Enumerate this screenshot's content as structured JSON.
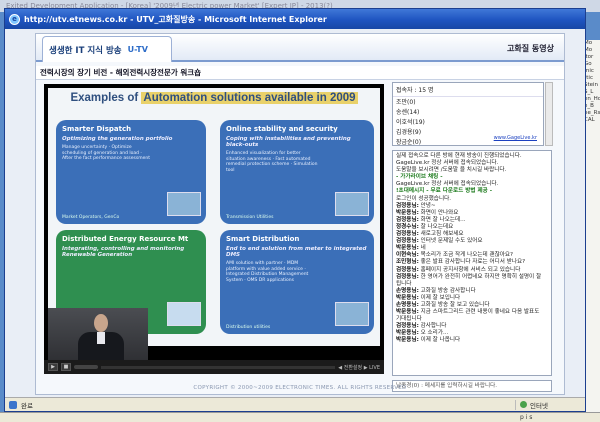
{
  "background": {
    "top_strip": "Exited Development Application - [Korea] '2009년 Electric power Market' [Expert IP] - 2013(?)"
  },
  "window": {
    "title": "http://utv.etnews.co.kr - UTV_고화질방송 - Microsoft Internet Explorer"
  },
  "popup": {
    "tab_label": "생생한 IT 지식 방송",
    "logo": "U-TV",
    "channel": "고화질 동영상",
    "subtitle": "전력시장의 장기 비전 - 해외전력시장전문가 워크숍",
    "copyright": "COPYRIGHT © 2000~2009 ELECTRONIC TIMES. ALL RIGHTS RESERVED"
  },
  "slide": {
    "title_prefix": "Examples of ",
    "title_highlight": "Automation solutions available in 2009",
    "cards": [
      {
        "title": "Smarter Dispatch",
        "italic": "Optimizing the generation portfolio",
        "items": "Manage uncertainty · Optimize scheduling of generation and load · After the fact performance assessment",
        "tag": "Market Operators, GenCo"
      },
      {
        "title": "Online stability and security",
        "italic": "Coping with instabilities and preventing black-outs",
        "items": "Enhanced visualization for better situation awareness · Fast automated remedial protection scheme · Simulation tool",
        "tag": "Transmission Utilities"
      },
      {
        "title": "Distributed Energy Resource Mt",
        "italic": "Integrating, controlling and monitoring Renewable Generation",
        "items": "",
        "tag": ""
      },
      {
        "title": "Smart Distribution",
        "italic": "End to end solution from meter to integrated DMS",
        "items": "AMI solution with partner · MDM platform with value added service · Integrated Distribution Management System · OMS DR applications",
        "tag": "Distribution utilities"
      }
    ]
  },
  "player": {
    "status_label": "◀ 전환설정 ▶ LIVE"
  },
  "users": {
    "header": "접속자 : 15 명",
    "list": [
      "조만(0)",
      "송센(14)",
      "이호석(19)",
      "김경용(9)",
      "장금순(0)"
    ],
    "link": "www.GageLive.kr"
  },
  "chat": {
    "lines": [
      {
        "style": "n",
        "text": "실제 접속으로 다른 방에 현재 방송이 진행되었습니다."
      },
      {
        "style": "n",
        "text": "GageLive.kr 정상 서버에 접속되었습니다."
      },
      {
        "style": "n",
        "text": "도움말을 보시려면 /도움말 을 치시길 바랍니다."
      },
      {
        "style": "g",
        "text": "- 가가라이브 채팅 -"
      },
      {
        "style": "n",
        "text": "GageLive.kr 정상 서버에 접속되었습니다."
      },
      {
        "style": "g",
        "text": "!초대메시지 - 무료 다운로드 방법 제공 -"
      },
      {
        "style": "n",
        "text": "로그인이 성공했습니다."
      },
      {
        "style": "b",
        "name": "검정용님:",
        "text": " 안녕~"
      },
      {
        "style": "b",
        "name": "박문용님:",
        "text": " 화면이 안나와요"
      },
      {
        "style": "b",
        "name": "검정용님:",
        "text": " 화면 잘 나오는데..."
      },
      {
        "style": "b",
        "name": "정경수님:",
        "text": " 잘 나오는데요"
      },
      {
        "style": "b",
        "name": "검정용님:",
        "text": " 새로고침 해보세요"
      },
      {
        "style": "b",
        "name": "검정용님:",
        "text": " 인터넷 문제일 수도 있어요"
      },
      {
        "style": "b",
        "name": "박문용님:",
        "text": " 네"
      },
      {
        "style": "b",
        "name": "이현숙님:",
        "text": " 목소리가 조금 작게 나오는데 괜찮아요?"
      },
      {
        "style": "b",
        "name": "조민형님:",
        "text": " 좋은 발표 감사합니다 자료는 어디서 받나요?"
      },
      {
        "style": "b",
        "name": "검정용님:",
        "text": " 홈페이지 공지사항에 서비스 되고 있습니다"
      },
      {
        "style": "b",
        "name": "검정용님:",
        "text": " 한 영어가 완전히 어렵네요 하지만 명확히 설명이 잘 됩니다"
      },
      {
        "style": "b",
        "name": "손명용님:",
        "text": " 고화질 방송 감사합니다"
      },
      {
        "style": "b",
        "name": "박문용님:",
        "text": " 이제 잘 보입니다"
      },
      {
        "style": "b",
        "name": "손명용님:",
        "text": " 고화질 방송 잘 보고 있습니다"
      },
      {
        "style": "b",
        "name": "박문용님:",
        "text": " 지금 스마트그리드 관련 내용이 좋네요 다음 발표도 기대됩니다"
      },
      {
        "style": "b",
        "name": "검정용님:",
        "text": " 감사합니다"
      },
      {
        "style": "b",
        "name": "박문용님:",
        "text": " 오 소리가..."
      },
      {
        "style": "b",
        "name": "박문용님:",
        "text": " 이제 잘 나옵니다"
      }
    ],
    "input_placeholder": "날종경(0) : 메세지를 입력하시길 바랍니다."
  },
  "statusbar": {
    "left": "완료",
    "zone": "인터넷"
  },
  "right_peek": [
    "Mo",
    "Mo",
    "itor",
    "Go",
    "mic",
    "rtic",
    "Stein",
    "S_L",
    "en_Ho",
    "e_B",
    "ne_Rs",
    "CAL"
  ],
  "bottom_peek": "p   i   s"
}
